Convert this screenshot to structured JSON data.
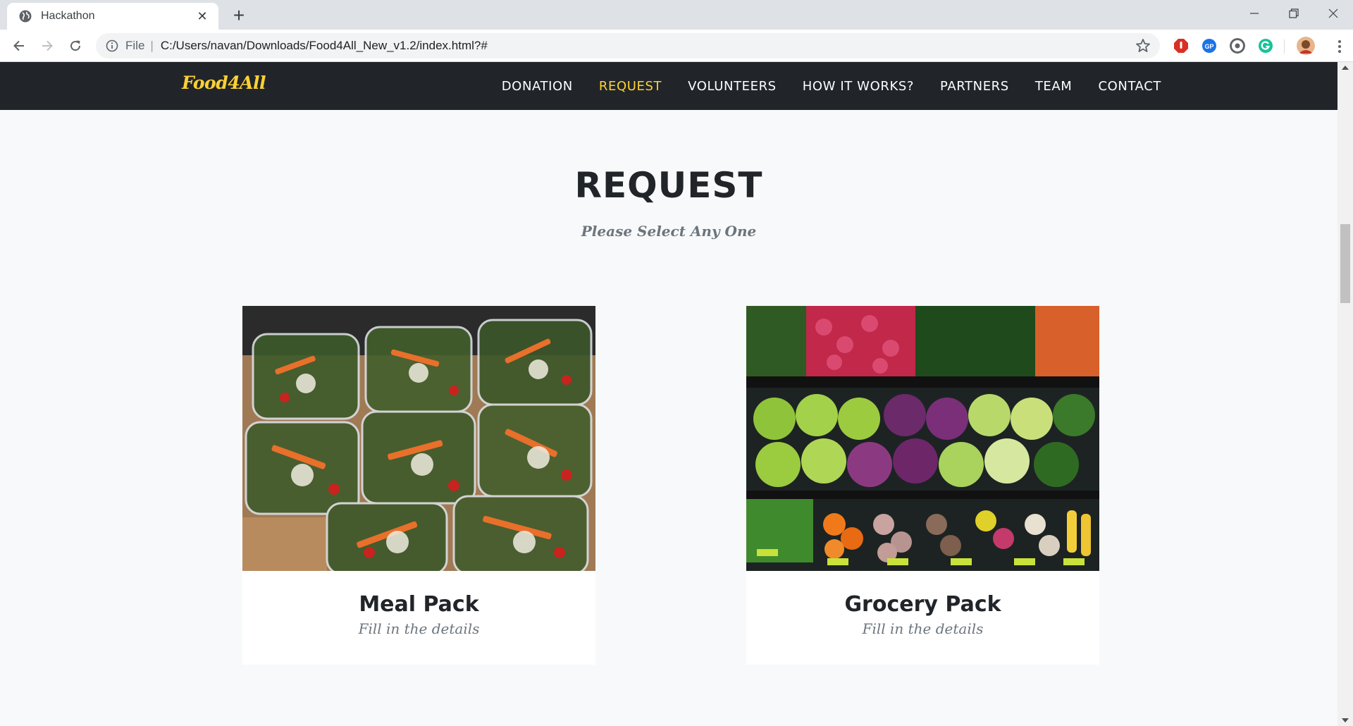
{
  "browser": {
    "tab_title": "Hackathon",
    "url_scheme": "File",
    "url": "C:/Users/navan/Downloads/Food4All_New_v1.2/index.html?#"
  },
  "site": {
    "brand": "Food4All",
    "nav": [
      {
        "label": "DONATION",
        "active": false
      },
      {
        "label": "REQUEST",
        "active": true
      },
      {
        "label": "VOLUNTEERS",
        "active": false
      },
      {
        "label": "HOW IT WORKS?",
        "active": false
      },
      {
        "label": "PARTNERS",
        "active": false
      },
      {
        "label": "TEAM",
        "active": false
      },
      {
        "label": "CONTACT",
        "active": false
      }
    ]
  },
  "request": {
    "heading": "REQUEST",
    "subheading": "Please Select Any One",
    "cards": [
      {
        "title": "Meal Pack",
        "caption": "Fill in the details",
        "image": "salad-containers-photo"
      },
      {
        "title": "Grocery Pack",
        "caption": "Fill in the details",
        "image": "vegetable-display-photo"
      }
    ]
  },
  "colors": {
    "accent": "#fed136",
    "navbar": "#212529",
    "page_bg": "#f8f9fa",
    "heading": "#212529",
    "muted": "#6c757d"
  }
}
